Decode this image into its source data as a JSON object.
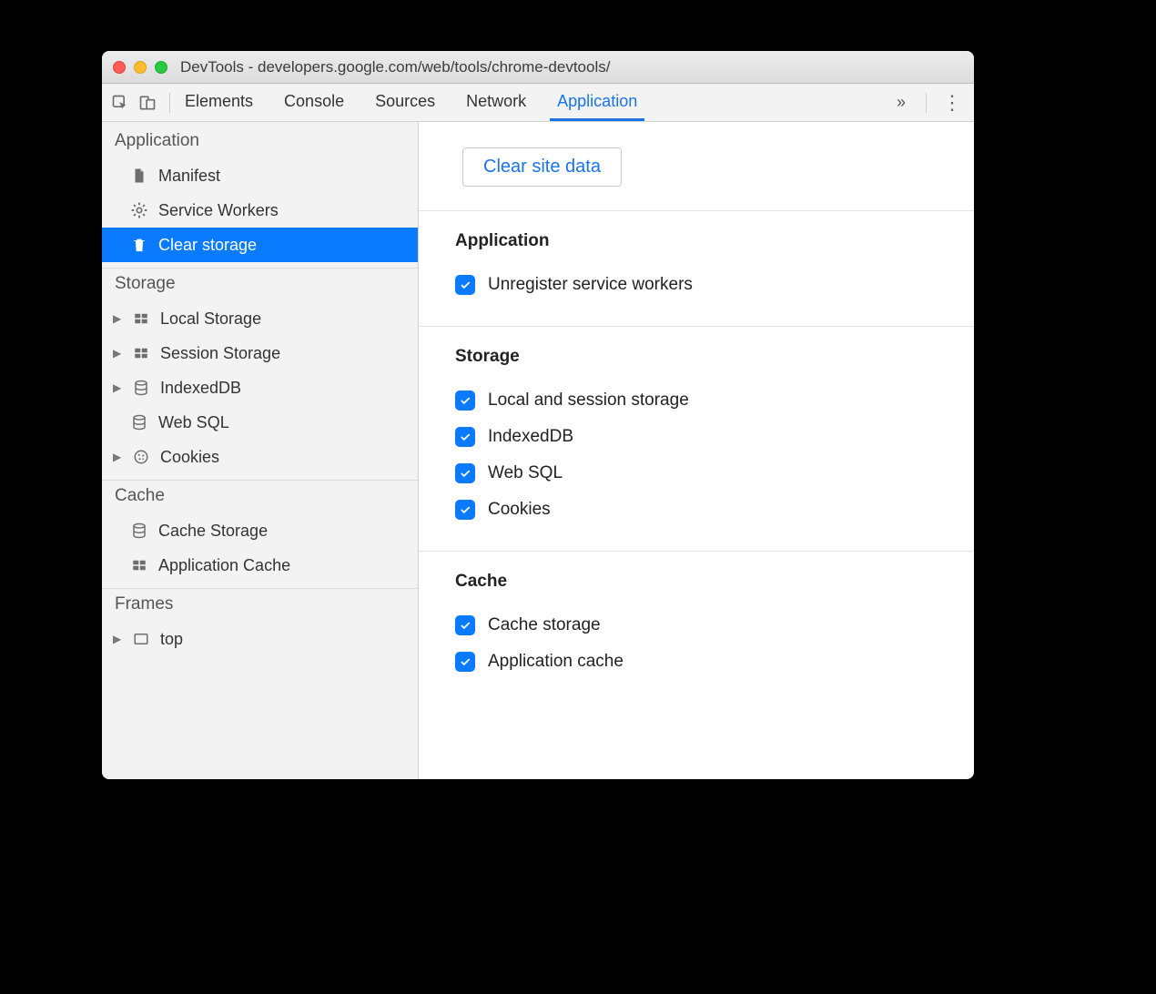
{
  "window": {
    "title": "DevTools - developers.google.com/web/tools/chrome-devtools/"
  },
  "tabs": {
    "items": [
      "Elements",
      "Console",
      "Sources",
      "Network",
      "Application"
    ],
    "active_index": 4
  },
  "sidebar": {
    "groups": [
      {
        "header": "Application",
        "items": [
          {
            "icon": "file-icon",
            "label": "Manifest",
            "expandable": false
          },
          {
            "icon": "gear-icon",
            "label": "Service Workers",
            "expandable": false
          },
          {
            "icon": "trash-icon",
            "label": "Clear storage",
            "expandable": false,
            "selected": true
          }
        ]
      },
      {
        "header": "Storage",
        "items": [
          {
            "icon": "grid-icon",
            "label": "Local Storage",
            "expandable": true
          },
          {
            "icon": "grid-icon",
            "label": "Session Storage",
            "expandable": true
          },
          {
            "icon": "db-icon",
            "label": "IndexedDB",
            "expandable": true
          },
          {
            "icon": "db-icon",
            "label": "Web SQL",
            "expandable": false
          },
          {
            "icon": "cookie-icon",
            "label": "Cookies",
            "expandable": true
          }
        ]
      },
      {
        "header": "Cache",
        "items": [
          {
            "icon": "db-icon",
            "label": "Cache Storage",
            "expandable": false
          },
          {
            "icon": "grid-icon",
            "label": "Application Cache",
            "expandable": false
          }
        ]
      },
      {
        "header": "Frames",
        "items": [
          {
            "icon": "frame-icon",
            "label": "top",
            "expandable": true
          }
        ]
      }
    ]
  },
  "main": {
    "clear_button": "Clear site data",
    "sections": [
      {
        "header": "Application",
        "checks": [
          {
            "label": "Unregister service workers",
            "checked": true
          }
        ]
      },
      {
        "header": "Storage",
        "checks": [
          {
            "label": "Local and session storage",
            "checked": true
          },
          {
            "label": "IndexedDB",
            "checked": true
          },
          {
            "label": "Web SQL",
            "checked": true
          },
          {
            "label": "Cookies",
            "checked": true
          }
        ]
      },
      {
        "header": "Cache",
        "checks": [
          {
            "label": "Cache storage",
            "checked": true
          },
          {
            "label": "Application cache",
            "checked": true
          }
        ]
      }
    ]
  }
}
